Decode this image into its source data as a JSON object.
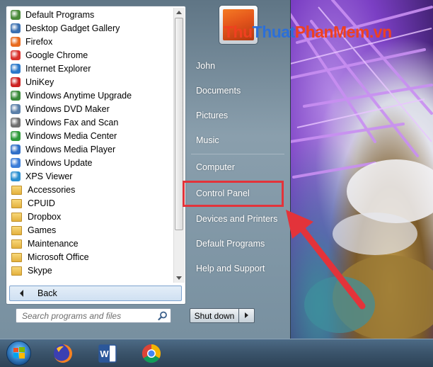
{
  "programs": [
    {
      "label": "Default Programs",
      "icon": "default-programs-icon",
      "color": "#4a8a3a"
    },
    {
      "label": "Desktop Gadget Gallery",
      "icon": "gadget-icon",
      "color": "#3a6fb0"
    },
    {
      "label": "Firefox",
      "icon": "firefox-icon",
      "color": "#e86a1e"
    },
    {
      "label": "Google Chrome",
      "icon": "chrome-icon",
      "color": "#d8322d"
    },
    {
      "label": "Internet Explorer",
      "icon": "internet-explorer-icon",
      "color": "#2a77c9"
    },
    {
      "label": "UniKey",
      "icon": "unikey-icon",
      "color": "#cc2222"
    },
    {
      "label": "Windows Anytime Upgrade",
      "icon": "windows-flag-icon",
      "color": "#3a8a3a"
    },
    {
      "label": "Windows DVD Maker",
      "icon": "dvd-icon",
      "color": "#5a7fa8"
    },
    {
      "label": "Windows Fax and Scan",
      "icon": "fax-icon",
      "color": "#707070"
    },
    {
      "label": "Windows Media Center",
      "icon": "media-center-icon",
      "color": "#2e9a3a"
    },
    {
      "label": "Windows Media Player",
      "icon": "media-player-icon",
      "color": "#2f6fc8"
    },
    {
      "label": "Windows Update",
      "icon": "windows-update-icon",
      "color": "#3b7dd8"
    },
    {
      "label": "XPS Viewer",
      "icon": "xps-icon",
      "color": "#2b8fd0"
    },
    {
      "label": "Accessories",
      "icon": "folder-icon"
    },
    {
      "label": "CPUID",
      "icon": "folder-icon"
    },
    {
      "label": "Dropbox",
      "icon": "folder-icon"
    },
    {
      "label": "Games",
      "icon": "folder-icon"
    },
    {
      "label": "Maintenance",
      "icon": "folder-icon"
    },
    {
      "label": "Microsoft Office",
      "icon": "folder-icon"
    },
    {
      "label": "Skype",
      "icon": "folder-icon"
    }
  ],
  "back_label": "Back",
  "search": {
    "placeholder": "Search programs and files"
  },
  "watermark": {
    "part1": "Thu",
    "part2": "Thuat",
    "part3": "PhanMem",
    "part4": ".vn"
  },
  "right_pane": {
    "user": "John",
    "documents": "Documents",
    "pictures": "Pictures",
    "music": "Music",
    "computer": "Computer",
    "control_panel": "Control Panel",
    "devices": "Devices and Printers",
    "default_programs": "Default Programs",
    "help": "Help and Support"
  },
  "shutdown_label": "Shut down",
  "highlight_color": "#e3333a",
  "taskbar": {
    "icons": [
      "start-orb-icon",
      "firefox-icon",
      "word-icon",
      "chrome-icon"
    ]
  }
}
